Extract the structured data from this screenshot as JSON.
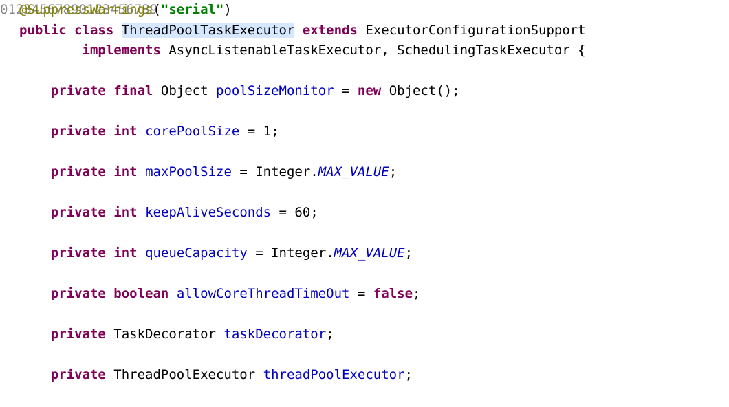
{
  "gutter": [
    "0",
    "1",
    "2",
    "3",
    "4",
    "5",
    "6",
    "7",
    "8",
    "9",
    "0",
    "1",
    "2",
    "3",
    "4",
    "5",
    "6",
    "7",
    "8",
    "9"
  ],
  "lines": [
    {
      "segments": [
        {
          "cls": "tok-annotation",
          "text": "@SuppressWarnings"
        },
        {
          "cls": "tok-punct",
          "text": "("
        },
        {
          "cls": "tok-string",
          "text": "\"serial\""
        },
        {
          "cls": "tok-punct",
          "text": ")"
        }
      ]
    },
    {
      "segments": [
        {
          "cls": "tok-keyword",
          "text": "public class"
        },
        {
          "cls": "tok-default",
          "text": " "
        },
        {
          "cls": "tok-class-decl highlight",
          "text": "ThreadPoolTaskExecutor"
        },
        {
          "cls": "tok-default",
          "text": " "
        },
        {
          "cls": "tok-keyword",
          "text": "extends"
        },
        {
          "cls": "tok-default",
          "text": " ExecutorConfigurationSupport"
        }
      ]
    },
    {
      "segments": [
        {
          "cls": "tok-default",
          "text": "        "
        },
        {
          "cls": "tok-keyword",
          "text": "implements"
        },
        {
          "cls": "tok-default",
          "text": " AsyncListenableTaskExecutor, SchedulingTaskExecutor {"
        }
      ]
    },
    {
      "segments": [
        {
          "cls": "tok-default",
          "text": ""
        }
      ]
    },
    {
      "segments": [
        {
          "cls": "tok-default",
          "text": "    "
        },
        {
          "cls": "tok-keyword",
          "text": "private final"
        },
        {
          "cls": "tok-default",
          "text": " Object "
        },
        {
          "cls": "tok-field",
          "text": "poolSizeMonitor"
        },
        {
          "cls": "tok-default",
          "text": " = "
        },
        {
          "cls": "tok-keyword",
          "text": "new"
        },
        {
          "cls": "tok-default",
          "text": " Object();"
        }
      ]
    },
    {
      "segments": [
        {
          "cls": "tok-default",
          "text": ""
        }
      ]
    },
    {
      "segments": [
        {
          "cls": "tok-default",
          "text": "    "
        },
        {
          "cls": "tok-keyword",
          "text": "private int"
        },
        {
          "cls": "tok-default",
          "text": " "
        },
        {
          "cls": "tok-field",
          "text": "corePoolSize"
        },
        {
          "cls": "tok-default",
          "text": " = 1;"
        }
      ]
    },
    {
      "segments": [
        {
          "cls": "tok-default",
          "text": ""
        }
      ]
    },
    {
      "segments": [
        {
          "cls": "tok-default",
          "text": "    "
        },
        {
          "cls": "tok-keyword",
          "text": "private int"
        },
        {
          "cls": "tok-default",
          "text": " "
        },
        {
          "cls": "tok-field",
          "text": "maxPoolSize"
        },
        {
          "cls": "tok-default",
          "text": " = Integer."
        },
        {
          "cls": "tok-static-field",
          "text": "MAX_VALUE"
        },
        {
          "cls": "tok-default",
          "text": ";"
        }
      ]
    },
    {
      "segments": [
        {
          "cls": "tok-default",
          "text": ""
        }
      ]
    },
    {
      "segments": [
        {
          "cls": "tok-default",
          "text": "    "
        },
        {
          "cls": "tok-keyword",
          "text": "private int"
        },
        {
          "cls": "tok-default",
          "text": " "
        },
        {
          "cls": "tok-field",
          "text": "keepAliveSeconds"
        },
        {
          "cls": "tok-default",
          "text": " = 60;"
        }
      ]
    },
    {
      "segments": [
        {
          "cls": "tok-default",
          "text": ""
        }
      ]
    },
    {
      "segments": [
        {
          "cls": "tok-default",
          "text": "    "
        },
        {
          "cls": "tok-keyword",
          "text": "private int"
        },
        {
          "cls": "tok-default",
          "text": " "
        },
        {
          "cls": "tok-field",
          "text": "queueCapacity"
        },
        {
          "cls": "tok-default",
          "text": " = Integer."
        },
        {
          "cls": "tok-static-field",
          "text": "MAX_VALUE"
        },
        {
          "cls": "tok-default",
          "text": ";"
        }
      ]
    },
    {
      "segments": [
        {
          "cls": "tok-default",
          "text": ""
        }
      ]
    },
    {
      "segments": [
        {
          "cls": "tok-default",
          "text": "    "
        },
        {
          "cls": "tok-keyword",
          "text": "private boolean"
        },
        {
          "cls": "tok-default",
          "text": " "
        },
        {
          "cls": "tok-field",
          "text": "allowCoreThreadTimeOut"
        },
        {
          "cls": "tok-default",
          "text": " = "
        },
        {
          "cls": "tok-keyword",
          "text": "false"
        },
        {
          "cls": "tok-default",
          "text": ";"
        }
      ]
    },
    {
      "segments": [
        {
          "cls": "tok-default",
          "text": ""
        }
      ]
    },
    {
      "segments": [
        {
          "cls": "tok-default",
          "text": "    "
        },
        {
          "cls": "tok-keyword",
          "text": "private"
        },
        {
          "cls": "tok-default",
          "text": " TaskDecorator "
        },
        {
          "cls": "tok-field",
          "text": "taskDecorator"
        },
        {
          "cls": "tok-default",
          "text": ";"
        }
      ]
    },
    {
      "segments": [
        {
          "cls": "tok-default",
          "text": ""
        }
      ]
    },
    {
      "segments": [
        {
          "cls": "tok-default",
          "text": "    "
        },
        {
          "cls": "tok-keyword",
          "text": "private"
        },
        {
          "cls": "tok-default",
          "text": " ThreadPoolExecutor "
        },
        {
          "cls": "tok-field",
          "text": "threadPoolExecutor"
        },
        {
          "cls": "tok-default",
          "text": ";"
        }
      ]
    },
    {
      "segments": [
        {
          "cls": "tok-default",
          "text": ""
        }
      ]
    }
  ]
}
